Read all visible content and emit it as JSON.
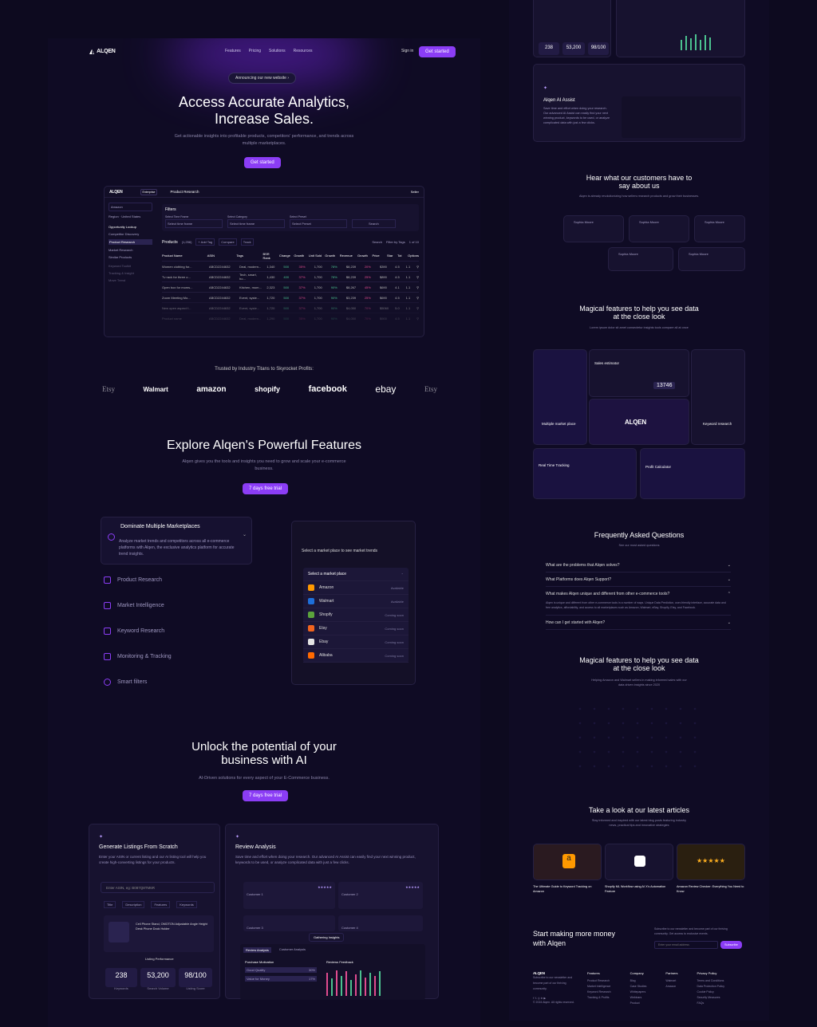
{
  "header": {
    "logo": "ALQEN",
    "nav": [
      "Features",
      "Pricing",
      "Solutions",
      "Resources"
    ],
    "signin": "Sign in",
    "cta": "Get started"
  },
  "hero": {
    "announce": "Announcing our new website",
    "title_line1": "Access Accurate Analytics,",
    "title_line2": "Increase Sales.",
    "subtitle": "Get actionable insights into profitable products, competitors' performance, and trends across multiple marketplaces.",
    "cta": "Get started"
  },
  "dashboard": {
    "logo": "ALQEN",
    "badge": "Enterprise",
    "page": "Product Research",
    "seller": "Seller",
    "marketplace": "Amazon",
    "region_label": "Region",
    "region": "United States",
    "side_section": "Opportunity Lookup",
    "side_items": [
      "Competitor Discovery",
      "Product Research",
      "Market Research",
      "Similar Products"
    ],
    "side_more": [
      "Keyword Toolkit",
      "Tracking & Insight",
      "Move Trend"
    ],
    "filters_title": "Filters",
    "filter_labels": [
      "Select Time Frame",
      "Select Category",
      "Select Preset"
    ],
    "filter_values": [
      "Select time frame",
      "Select time frame",
      "Select Preset"
    ],
    "search_btn": "Search",
    "products_label": "Products",
    "products_count": "(1,256)",
    "add_tag": "+ Add Tag",
    "compare": "Compare",
    "track": "Track",
    "search_small": "Search",
    "filter_tags": "Filter by Tags",
    "page_info": "1 of 10",
    "columns": [
      "Product Name",
      "ASIN",
      "Tags",
      "BSR Rank",
      "Change",
      "Growth",
      "Unit Sold",
      "Growth",
      "Revenue",
      "Growth",
      "Price",
      "Star",
      "Tot",
      "Options"
    ],
    "col_groups": [
      "BSR",
      "Past 30 Days",
      "Past 30 Days",
      "BSR"
    ],
    "rows": [
      [
        "Women clothing for...",
        "ABCD2244632",
        "Deal, modern...",
        "1,340",
        "500",
        "35%",
        "1,700",
        "78%",
        "$8,239",
        "20%",
        "$390",
        "4.5",
        "1.1"
      ],
      [
        "Tv rack for three o...",
        "ABCD2244632",
        "Tech, smart, ho...",
        "1,430",
        "400",
        "37%",
        "1,700",
        "78%",
        "$8,239",
        "25%",
        "$890",
        "4.5",
        "1.1"
      ],
      [
        "Open box for moms...",
        "ABCD2244632",
        "Kitchen, mom...",
        "2,323",
        "500",
        "37%",
        "1,700",
        "90%",
        "$8,267",
        "45%",
        "$690",
        "4.1",
        "1.1"
      ],
      [
        "Zoom Meeting Mo...",
        "ABCD2244632",
        "Event, syste...",
        "1,720",
        "500",
        "37%",
        "1,700",
        "90%",
        "$3,239",
        "25%",
        "$690",
        "4.5",
        "1.1"
      ],
      [
        "New open aspect f...",
        "ABCD2244632",
        "Event, syste...",
        "1,720",
        "500",
        "37%",
        "1,700",
        "90%",
        "$4,050",
        "70%",
        "$5060",
        "5.0",
        "1.1"
      ],
      [
        "Product name",
        "ABCD2244632",
        "Deal, modern...",
        "1,290",
        "500",
        "35%",
        "1,700",
        "90%",
        "$4,050",
        "70%",
        "$900",
        "4.5",
        "1.1"
      ]
    ]
  },
  "trusted": {
    "title": "Trusted by Industry Titans to Skyrocket Profits:",
    "logos": [
      "Etsy",
      "Walmart",
      "amazon",
      "shopify",
      "facebook",
      "ebay",
      "Etsy"
    ]
  },
  "explore": {
    "title": "Explore Alqen's Powerful Features",
    "subtitle": "Alqen gives you the tools and insights you need to grow and scale your e-commerce business.",
    "cta": "7 days free trial",
    "active_title": "Dominate Multiple Marketplaces",
    "active_desc": "Analyze market trends and competitors across all e-commerce platforms with Alqen, the exclusive analytics platform for accurate trend insights.",
    "items": [
      "Product Research",
      "Market Intelligence",
      "Keyword Research",
      "Monitoring & Tracking",
      "Smart filters"
    ],
    "panel_title": "Select a market place to see market trends",
    "panel_select": "Select a market place",
    "markets": [
      {
        "name": "Amazon",
        "status": "Available",
        "color": "#ff9900"
      },
      {
        "name": "Walmart",
        "status": "Available",
        "color": "#1e6fd9"
      },
      {
        "name": "Shopify",
        "status": "Coming soon",
        "color": "#5ba33c"
      },
      {
        "name": "Etsy",
        "status": "Coming soon",
        "color": "#f1641e"
      },
      {
        "name": "Ebay",
        "status": "Coming soon",
        "color": "#e4e4e4"
      },
      {
        "name": "Alibaba",
        "status": "Coming soon",
        "color": "#ff6a00"
      }
    ]
  },
  "ai": {
    "title_line1": "Unlock the potential of your",
    "title_line2": "business with AI",
    "subtitle": "AI-Driven solutions for every aspect of your E-Commerce business.",
    "cta": "7 days free trial",
    "card1_title": "Generate Listings From Scratch",
    "card1_desc": "Enter your ASIN or current listing and our AI listing tool will help you create high-converting listings for your products.",
    "card1_input": "Enter ASIN, eg: B087Q8TM6R",
    "card1_tags": [
      "Title",
      "Description",
      "Features",
      "Keywords"
    ],
    "card1_product": "Cell Phone Stand, OMOTON Adjustable Angle Height Desk Phone Dock Holder",
    "card1_perf": "Listing Performance",
    "stats": [
      {
        "value": "238",
        "label": "Keywords"
      },
      {
        "value": "53,200",
        "label": "Search Volume"
      },
      {
        "value": "98/100",
        "label": "Listing Score"
      }
    ],
    "card2_title": "Review Analysis",
    "card2_desc": "Save time and effort when doing your research. Our advanced AI Assist can easily find your next winning product, keywords to be used, or analyze complicated data with just a few clicks.",
    "customers": [
      "Customer 1",
      "Customer 2",
      "Customer 3",
      "Customer 4"
    ],
    "gathering": "Gathering Insights",
    "tabs": [
      "Review Analysis",
      "Customer Analysis"
    ],
    "purchase": "Purchase Motivation",
    "purchase_items": [
      "Good Quality",
      "Value for Money"
    ],
    "purchase_pct": [
      "30%",
      "17%"
    ],
    "reviews_feedback": "Reviews Feedback"
  },
  "right": {
    "assist_title": "Alqen AI Assist",
    "assist_desc": "Save time and effort when doing your research. Our advanced AI Assist can easily find your next winning product, keywords to be used, or analyze complicated data with just a few clicks.",
    "top_stats": [
      "238",
      "53,200",
      "98/100"
    ],
    "testimonials_title_line1": "Hear what our customers have to",
    "testimonials_title_line2": "say about us",
    "testimonials_sub": "Alqen is already revolutionizing how sellers research products and grow their businesses.",
    "reviewers": [
      "Sophia Moore",
      "Sophia Moore",
      "Sophia Moore",
      "Sophia Moore",
      "Sophia Moore"
    ],
    "magical_title_line1": "Magical features to help you see data",
    "magical_title_line2": "at the close look",
    "magical_sub": "Lorem ipsum dolor sit amet consectetur insights tools compare all at once",
    "tiles": [
      "Multiple market place",
      "Sales estimator",
      "Keyword research",
      "Real Time Tracking",
      "Profit Calculator"
    ],
    "sales_value": "13746",
    "tile_logo": "ALQEN",
    "faq_title": "Frequently Asked Questions",
    "faq_sub": "See our most asked questions",
    "faqs": [
      "What are the problems that Alqen solves?",
      "What Platforms does Alqen Support?",
      "What makes Alqen unique and different from other e-commerce tools?",
      "How can I get started with Alqen?"
    ],
    "faq_answer": "Alqen is unique and different from other e-commerce tools in a number of ways. Unique Data Prediction, user-friendly interface, accurate data and free analytics, affordability, and access to all marketplaces such as Amazon, Walmart, eBay, Shopify, Etsy, and Facebook.",
    "magical2_title_line1": "Magical features to help you see data",
    "magical2_title_line2": "at the close look",
    "magical2_sub": "Helping Amazon and Walmart sellers in making informed sales with our data driven insights since 2020",
    "articles_title": "Take a look at our latest articles",
    "articles_sub": "Stay informed and inspired with our latest blog posts featuring industry news, practical tips and innovative strategies",
    "articles": [
      "The Ultimate Guide to Keyword Tracking on Amazon",
      "Shopify ML Workflow using AI X's Automation Feature",
      "Amazon Review Checker: Everything You Need to Know"
    ],
    "cta_title_line1": "Start making more money",
    "cta_title_line2": "with Alqen",
    "cta_desc": "Subscribe to our newsletter and become part of our thriving community. Get access to exclusive events.",
    "email_placeholder": "Enter your email address",
    "subscribe": "Subscribe",
    "footer_logo": "ALQEN",
    "footer_desc": "Subscribe to our newsletter and become part of our thriving community.",
    "footer_cols": [
      {
        "title": "Features",
        "items": [
          "Product Research",
          "Market Intelligence",
          "Keyword Research",
          "Tracking & Profits"
        ]
      },
      {
        "title": "Company",
        "items": [
          "Blog",
          "Case Studies",
          "Whitepapers",
          "Webinars",
          "Product"
        ]
      },
      {
        "title": "Partners",
        "items": [
          "Walmart",
          "Amazon"
        ]
      },
      {
        "title": "Privacy Policy",
        "items": [
          "Terms and Conditions",
          "Data Protection Policy",
          "Cookie Policy",
          "Security Measures",
          "FAQs"
        ]
      }
    ],
    "copyright": "© 2024 Alqen. All rights reserved."
  }
}
